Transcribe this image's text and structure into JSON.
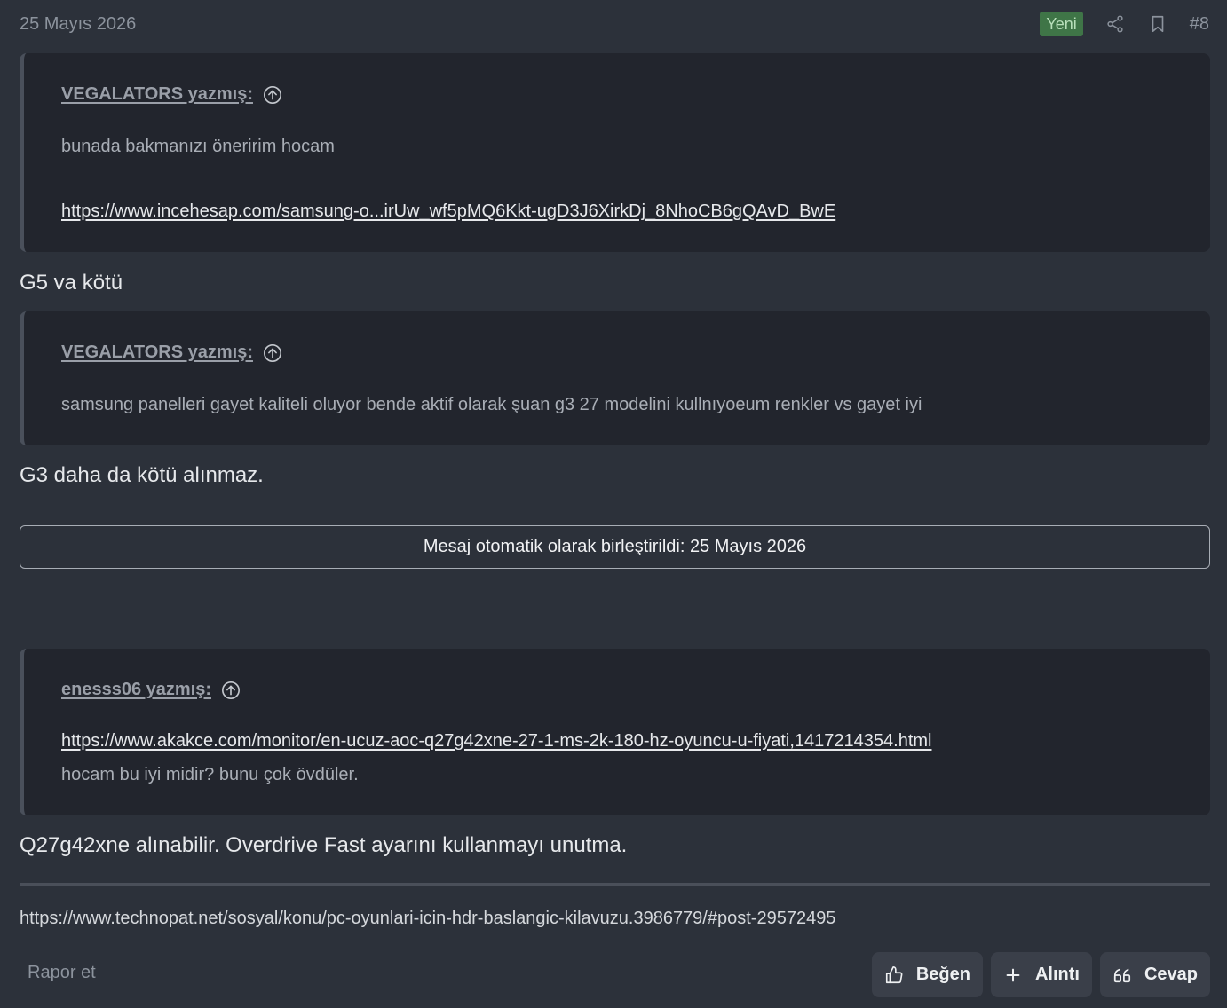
{
  "post": {
    "date": "25 Mayıs 2026",
    "badge": "Yeni",
    "number": "#8",
    "share_icon": "share-icon",
    "bookmark_icon": "bookmark-icon"
  },
  "quotes": [
    {
      "author": "VEGALATORS yazmış:",
      "text": "bunada bakmanızı öneririm hocam",
      "link": "https://www.incehesap.com/samsung-o...irUw_wf5pMQ6Kkt-ugD3J6XirkDj_8NhoCB6gQAvD_BwE"
    },
    {
      "author": "VEGALATORS yazmış:",
      "text": "samsung panelleri gayet kaliteli oluyor bende aktif olarak şuan g3 27 modelini kullnıyoeum renkler vs gayet iyi"
    },
    {
      "author": "enesss06 yazmış:",
      "link": "https://www.akakce.com/monitor/en-ucuz-aoc-q27g42xne-27-1-ms-2k-180-hz-oyuncu-u-fiyati,1417214354.html",
      "text": "hocam bu iyi midir? bunu çok övdüler."
    }
  ],
  "replies": [
    "G5 va kötü",
    "G3 daha da kötü alınmaz.",
    "Q27g42xne alınabilir. Overdrive Fast ayarını kullanmayı unutma."
  ],
  "merge_notice": "Mesaj otomatik olarak birleştirildi: 25 Mayıs 2026",
  "signature_link": "https://www.technopat.net/sosyal/konu/pc-oyunlari-icin-hdr-baslangic-kilavuzu.3986779/#post-29572495",
  "footer": {
    "report": "Rapor et",
    "like": "Beğen",
    "quote": "Alıntı",
    "reply": "Cevap"
  },
  "colors": {
    "background": "#2c313a",
    "quote_background": "#22252d",
    "badge_background": "#3f7547",
    "button_background": "#3a3f49"
  }
}
